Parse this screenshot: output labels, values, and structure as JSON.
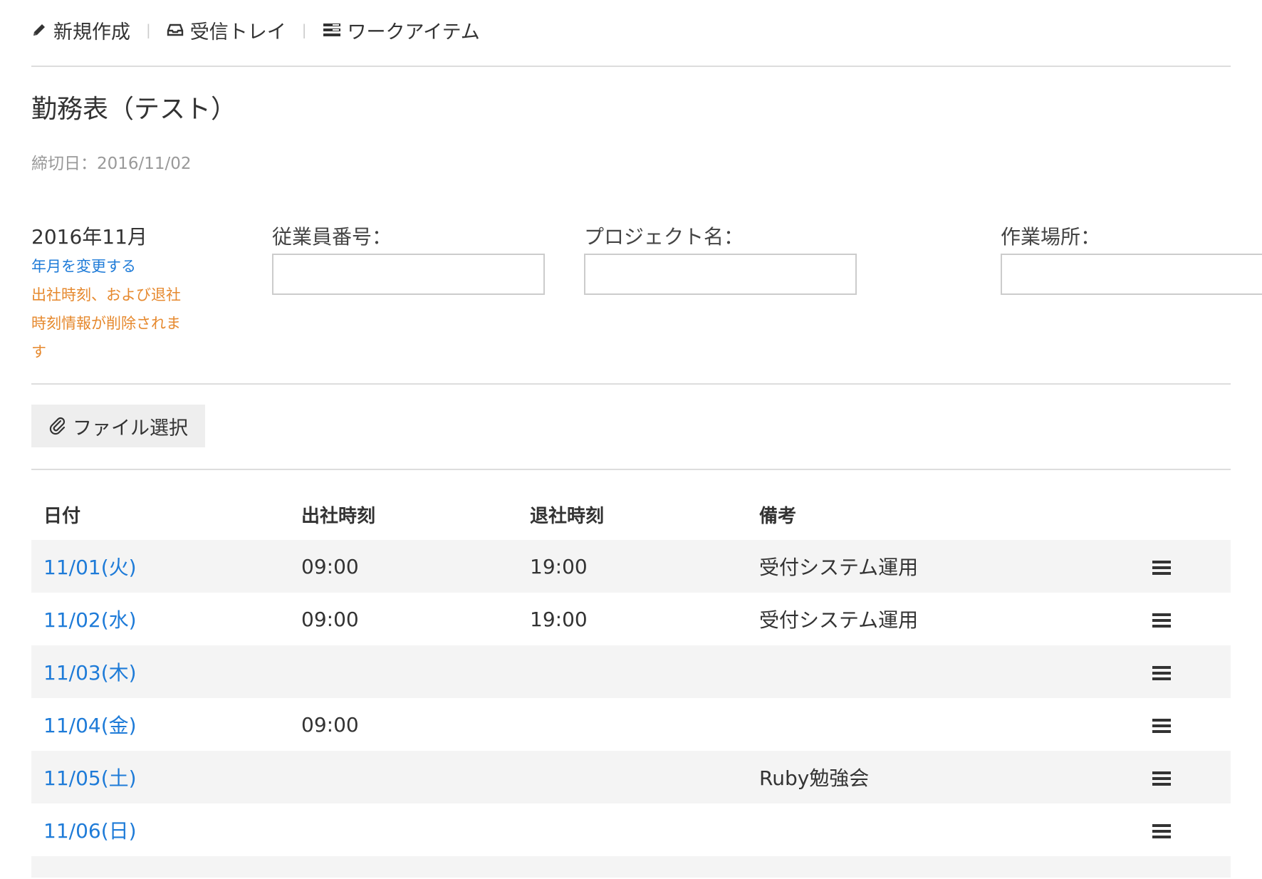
{
  "nav": {
    "new_label": "新規作成",
    "inbox_label": "受信トレイ",
    "workitem_label": "ワークアイテム",
    "separator": "|"
  },
  "title": "勤務表（テスト）",
  "deadline": "締切日：2016/11/02",
  "period": {
    "month_label": "2016年11月",
    "change_link": "年月を変更する",
    "warning": "出社時刻、および退社時刻情報が削除されます"
  },
  "fields": {
    "employee_label": "従業員番号：",
    "employee_value": "",
    "project_label": "プロジェクト名：",
    "project_value": "",
    "location_label": "作業場所：",
    "location_value": ""
  },
  "file_button_label": "ファイル選択",
  "table": {
    "headers": [
      "日付",
      "出社時刻",
      "退社時刻",
      "備考"
    ],
    "rows": [
      {
        "date": "11/01(火)",
        "start": "09:00",
        "end": "19:00",
        "note": "受付システム運用"
      },
      {
        "date": "11/02(水)",
        "start": "09:00",
        "end": "19:00",
        "note": "受付システム運用"
      },
      {
        "date": "11/03(木)",
        "start": "",
        "end": "",
        "note": ""
      },
      {
        "date": "11/04(金)",
        "start": "09:00",
        "end": "",
        "note": ""
      },
      {
        "date": "11/05(土)",
        "start": "",
        "end": "",
        "note": "Ruby勉強会"
      },
      {
        "date": "11/06(日)",
        "start": "",
        "end": "",
        "note": ""
      }
    ]
  },
  "icons": {
    "new": "pencil-icon",
    "inbox": "inbox-icon",
    "workitem": "list-icon",
    "file": "paperclip-icon",
    "row_menu": "hamburger-menu-icon"
  },
  "colors": {
    "link": "#1e7bd8",
    "warning": "#e6892e",
    "row_stripe": "#f4f4f4",
    "muted": "#999999"
  }
}
